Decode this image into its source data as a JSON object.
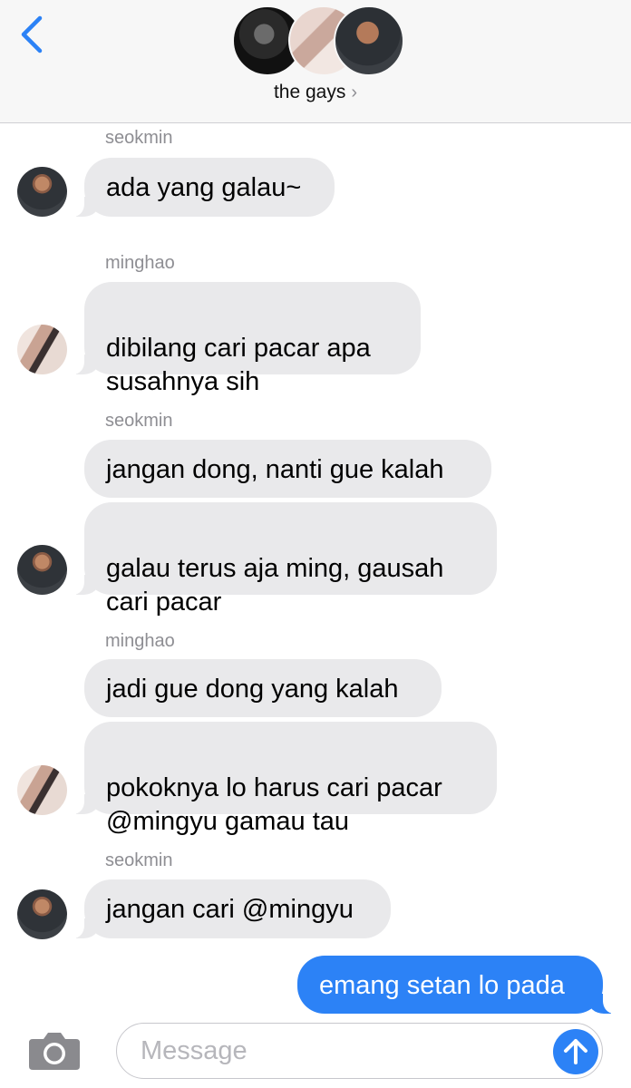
{
  "header": {
    "group_name": "the gays",
    "chevron": "›",
    "back_icon": "chevron-left-icon",
    "accent": "#2c82f6"
  },
  "messages": [
    {
      "sender": "seokmin",
      "texts": [
        "ada yang galau~"
      ]
    },
    {
      "sender": "minghao",
      "texts": [
        "dibilang cari pacar apa\nsusahnya sih"
      ]
    },
    {
      "sender": "seokmin",
      "texts": [
        "jangan dong, nanti gue kalah",
        "galau terus aja ming, gausah\ncari pacar"
      ]
    },
    {
      "sender": "minghao",
      "texts": [
        "jadi gue dong yang kalah",
        "pokoknya lo harus cari pacar\n@mingyu gamau tau"
      ]
    },
    {
      "sender": "seokmin",
      "texts": [
        "jangan cari @mingyu"
      ]
    },
    {
      "sender": "me",
      "texts": [
        "emang setan lo pada"
      ]
    }
  ],
  "input": {
    "placeholder": "Message",
    "camera_icon": "camera-icon",
    "send_icon": "arrow-up-icon"
  },
  "colors": {
    "incoming_bubble": "#e9e9eb",
    "outgoing_bubble": "#2c82f6",
    "meta_text": "#8e8e93"
  }
}
